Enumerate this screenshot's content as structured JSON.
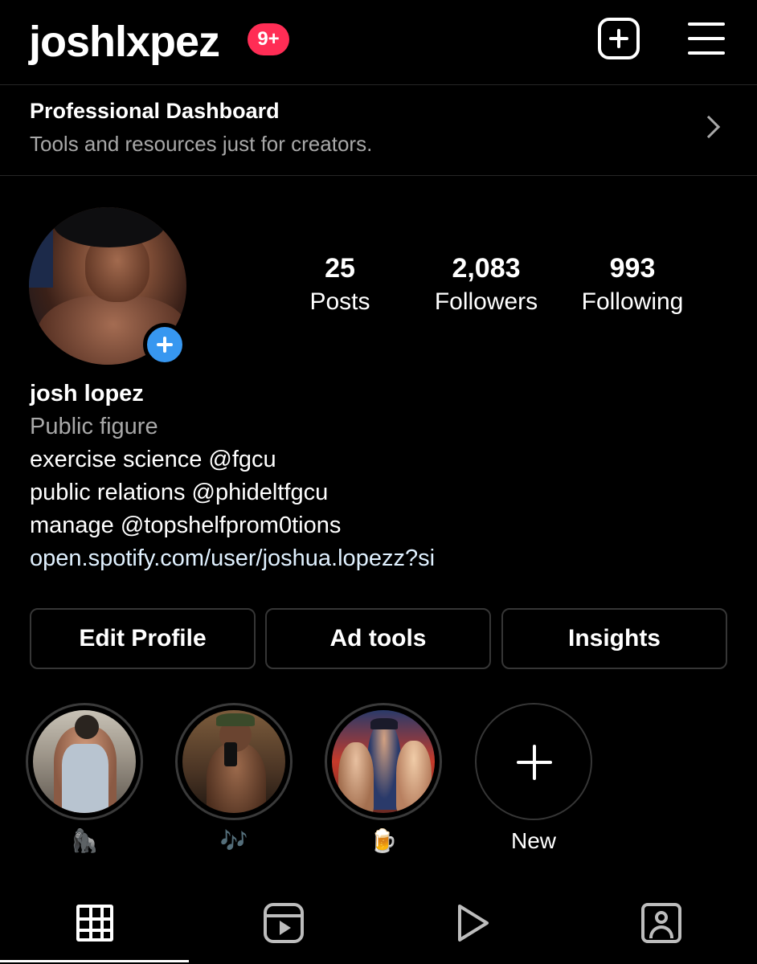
{
  "header": {
    "username": "joshlxpez",
    "notification_badge": "9+",
    "create_icon": "plus-square-icon",
    "menu_icon": "hamburger-menu-icon"
  },
  "dashboard": {
    "title": "Professional Dashboard",
    "subtitle": "Tools and resources just for creators.",
    "chevron_icon": "chevron-right-icon"
  },
  "profile": {
    "stats": {
      "posts": {
        "value": "25",
        "label": "Posts"
      },
      "followers": {
        "value": "2,083",
        "label": "Followers"
      },
      "following": {
        "value": "993",
        "label": "Following"
      }
    },
    "name": "josh lopez",
    "category": "Public figure",
    "bio_lines": [
      "exercise science @fgcu",
      "public relations @phideltfgcu",
      "manage @topshelfprom0tions"
    ],
    "link": "open.spotify.com/user/joshua.lopezz?si"
  },
  "buttons": {
    "edit_profile": "Edit Profile",
    "ad_tools": "Ad tools",
    "insights": "Insights"
  },
  "highlights": [
    {
      "label": "🦍"
    },
    {
      "label": "🎶"
    },
    {
      "label": "🍺"
    },
    {
      "label": "New"
    }
  ],
  "tabs": [
    {
      "icon": "grid-icon",
      "active": true
    },
    {
      "icon": "reels-icon",
      "active": false
    },
    {
      "icon": "video-play-icon",
      "active": false
    },
    {
      "icon": "tagged-icon",
      "active": false
    }
  ],
  "colors": {
    "background": "#000000",
    "badge": "#ff2d55",
    "accent_blue": "#3797f0",
    "secondary_text": "#a8a8a8",
    "link_text": "#e0f1ff"
  }
}
